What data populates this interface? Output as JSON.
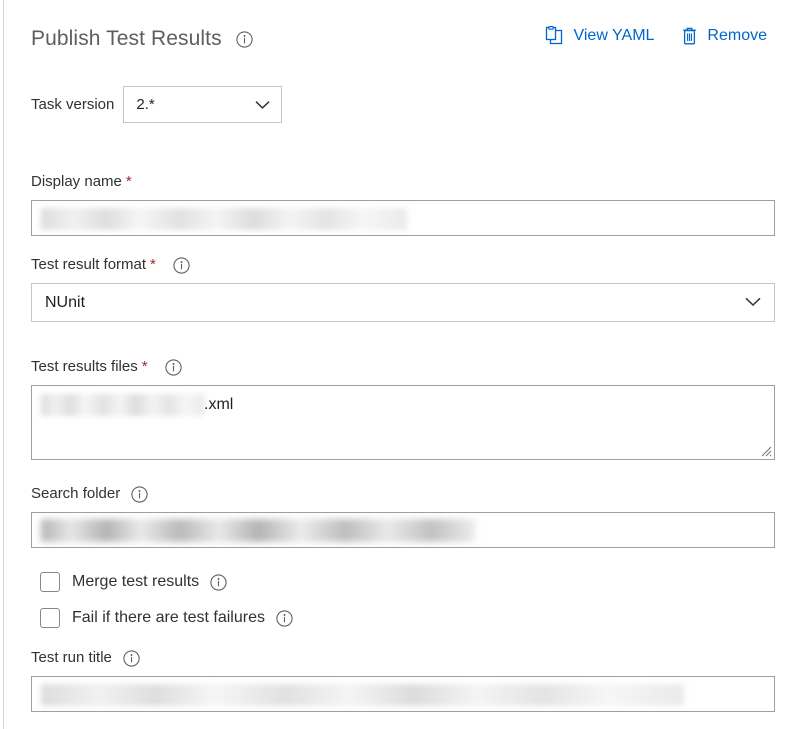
{
  "header": {
    "title": "Publish Test Results",
    "title_info_icon": "info-icon",
    "actions": [
      {
        "label": "View YAML",
        "icon": "clipboard-icon"
      },
      {
        "label": "Remove",
        "icon": "trash-icon"
      }
    ]
  },
  "task_version": {
    "label": "Task version",
    "value": "2.*",
    "chevron_icon": "chevron-down-icon"
  },
  "fields": {
    "display_name": {
      "label": "Display name",
      "required_marker": "*",
      "value": ""
    },
    "test_result_format": {
      "label": "Test result format",
      "required_marker": "*",
      "info_icon": "info-icon",
      "value": "NUnit",
      "chevron_icon": "chevron-down-icon"
    },
    "test_results_files": {
      "label": "Test results files",
      "required_marker": "*",
      "info_icon": "info-icon",
      "value_suffix": ".xml"
    },
    "search_folder": {
      "label": "Search folder",
      "info_icon": "info-icon",
      "value": ""
    },
    "test_run_title": {
      "label": "Test run title",
      "info_icon": "info-icon",
      "value": ""
    }
  },
  "checkboxes": [
    {
      "label": "Merge test results",
      "checked": false,
      "info_icon": "info-icon"
    },
    {
      "label": "Fail if there are test failures",
      "checked": false,
      "info_icon": "info-icon"
    }
  ],
  "colors": {
    "link": "#0066cc",
    "required": "#a4262c",
    "title": "#605e5c",
    "border": "#a19f9d"
  }
}
